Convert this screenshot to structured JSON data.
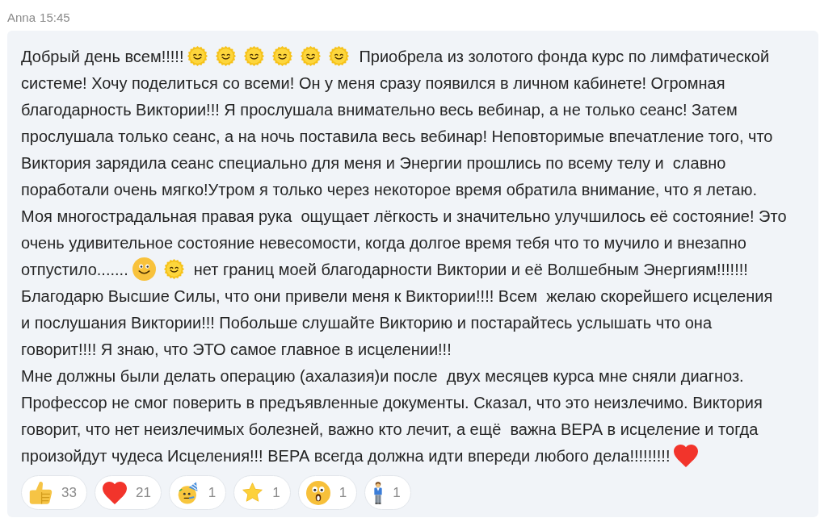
{
  "message": {
    "author": "Anna",
    "time": "15:45",
    "lines": [
      {
        "parts": [
          {
            "kind": "text",
            "text": "Добрый день всем!!!!!"
          },
          {
            "kind": "sun"
          },
          {
            "kind": "sun"
          },
          {
            "kind": "sun"
          },
          {
            "kind": "sun"
          },
          {
            "kind": "sun"
          },
          {
            "kind": "sun"
          },
          {
            "kind": "text",
            "text": "Приобрела из золотого фонда курс по лимфатической"
          }
        ]
      },
      {
        "parts": [
          {
            "kind": "text",
            "text": "системе! Хочу поделиться со всеми! Он у меня сразу появился в личном кабинете! Огромная"
          }
        ]
      },
      {
        "parts": [
          {
            "kind": "text",
            "text": "благодарность Виктории!!! Я прослушала внимательно весь вебинар, а не только сеанс! Затем"
          }
        ]
      },
      {
        "parts": [
          {
            "kind": "text",
            "text": "прослушала только сеанс, а на ночь поставила весь вебинар! Неповторимые впечатление того, что"
          }
        ]
      },
      {
        "parts": [
          {
            "kind": "text",
            "text": "Виктория зарядила сеанс специально для меня и Энергии прошлись по всему телу и  славно"
          }
        ]
      },
      {
        "parts": [
          {
            "kind": "text",
            "text": "поработали очень мягко!Утром я только через некоторое время обратила внимание, что я летаю."
          }
        ]
      },
      {
        "parts": [
          {
            "kind": "text",
            "text": "Моя многострадальная правая рука  ощущает лёгкость и значительно улучшилось её состояние! Это"
          }
        ]
      },
      {
        "parts": [
          {
            "kind": "text",
            "text": "очень удивительное состояние невесомости, когда долгое время тебя что то мучило и внезапно"
          }
        ]
      },
      {
        "parts": [
          {
            "kind": "text",
            "text": "отпустило......."
          },
          {
            "kind": "smiley"
          },
          {
            "kind": "sun"
          },
          {
            "kind": "text",
            "text": "нет границ моей благодарности Виктории и её Волшебным Энергиям!!!!!!!"
          }
        ]
      },
      {
        "parts": [
          {
            "kind": "text",
            "text": "Благодарю Высшие Силы, что они привели меня к Виктории!!!! Всем  желаю скорейшего исцеления"
          }
        ]
      },
      {
        "parts": [
          {
            "kind": "text",
            "text": "и послушания Виктории!!! Побольше слушайте Викторию и постарайтесь услышать что она"
          }
        ]
      },
      {
        "parts": [
          {
            "kind": "text",
            "text": "говорит!!!! Я знаю, что ЭТО самое главное в исцелении!!!"
          }
        ]
      },
      {
        "parts": [
          {
            "kind": "text",
            "text": "Мне должны были делать операцию (ахалазия)и после  двух месяцев курса мне сняли диагноз."
          }
        ]
      },
      {
        "parts": [
          {
            "kind": "text",
            "text": "Профессор не смог поверить в предъявленные документы. Сказал, что это неизлечимо. Виктория"
          }
        ]
      },
      {
        "parts": [
          {
            "kind": "text",
            "text": "говорит, что нет неизлечимых болезней, важно кто лечит, а ещё  важна ВЕРА в исцеление и тогда"
          }
        ]
      },
      {
        "parts": [
          {
            "kind": "text",
            "text": "произойдут чудеса Исцеления!!! ВЕРА всегда должна идти впереди любого дела!!!!!!!!!"
          },
          {
            "kind": "heart"
          }
        ]
      }
    ],
    "reactions": [
      {
        "kind": "thumbs-up",
        "count": "33"
      },
      {
        "kind": "heart",
        "count": "21"
      },
      {
        "kind": "party-face",
        "count": "1"
      },
      {
        "kind": "star",
        "count": "1"
      },
      {
        "kind": "surprised-face",
        "count": "1"
      },
      {
        "kind": "person",
        "count": "1"
      }
    ]
  }
}
